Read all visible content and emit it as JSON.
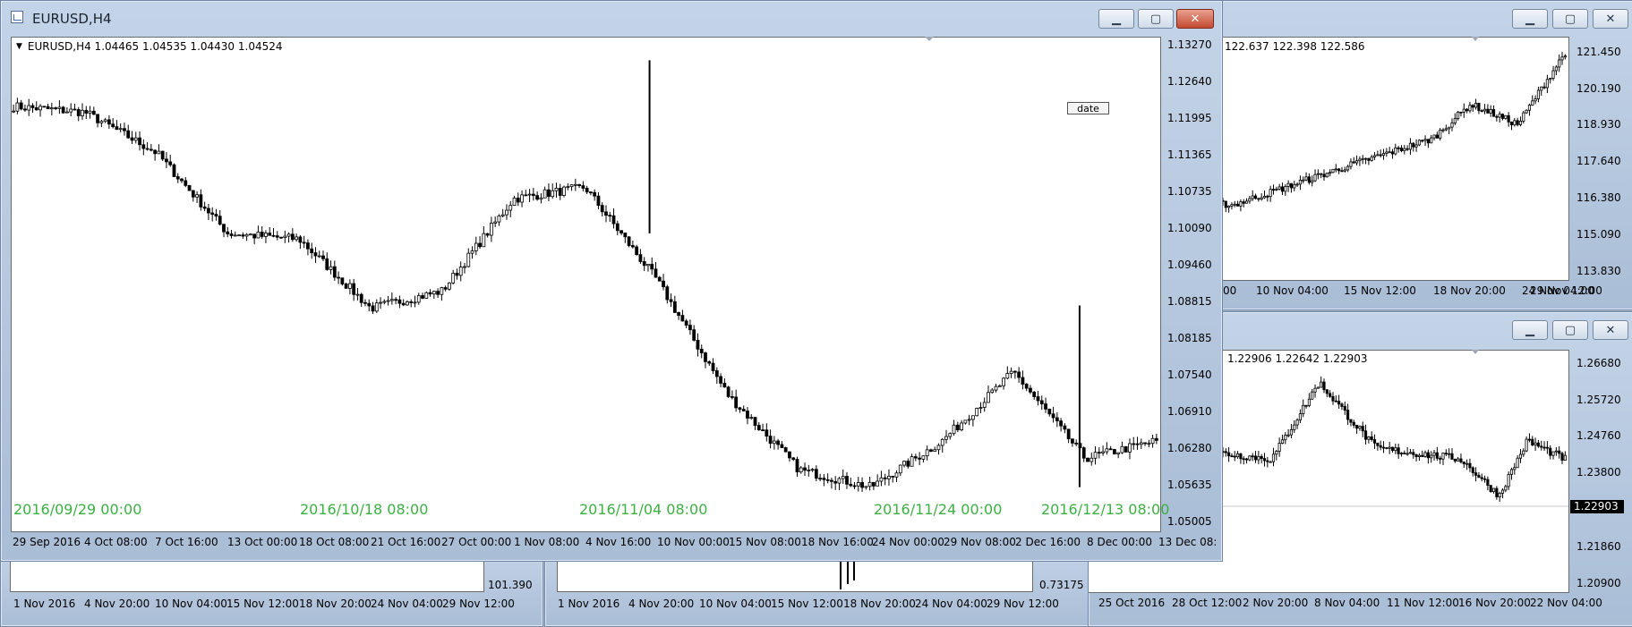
{
  "main_window": {
    "title": "EURUSD,H4",
    "ohlc_label": "EURUSD,H4  1.04465 1.04535 1.04430 1.04524",
    "date_button": "date",
    "y_ticks": [
      "1.13270",
      "1.12640",
      "1.11995",
      "1.11365",
      "1.10735",
      "1.10090",
      "1.09460",
      "1.08815",
      "1.08185",
      "1.07540",
      "1.06910",
      "1.06280",
      "1.05635",
      "1.05005"
    ],
    "x_ticks": [
      "29 Sep 2016",
      "4 Oct 08:00",
      "7 Oct 16:00",
      "13 Oct 00:00",
      "18 Oct 08:00",
      "21 Oct 16:00",
      "27 Oct 00:00",
      "1 Nov 08:00",
      "4 Nov 16:00",
      "10 Nov 00:00",
      "15 Nov 08:00",
      "18 Nov 16:00",
      "24 Nov 00:00",
      "29 Nov 08:00",
      "2 Dec 16:00",
      "8 Dec 00:00",
      "13 Dec 08:"
    ],
    "date_markers": [
      "2016/09/29 00:00",
      "2016/10/18 08:00",
      "2016/11/04 08:00",
      "2016/11/24 00:00",
      "2016/12/13 08:00"
    ],
    "colors": {
      "marker": "#3cb043",
      "candle": "#000000"
    }
  },
  "top_right_window": {
    "ohlc_label": "122.637 122.398 122.586",
    "y_ticks": [
      "121.450",
      "120.190",
      "118.930",
      "117.640",
      "116.380",
      "115.090",
      "113.830"
    ],
    "x_ticks": [
      "00",
      "10 Nov 04:00",
      "15 Nov 12:00",
      "18 Nov 20:00",
      "24 Nov 04:00",
      "29 Nov 12:00"
    ]
  },
  "bottom_right_window": {
    "ohlc_label": "1.22906 1.22642 1.22903",
    "price_tag": "1.22903",
    "y_ticks": [
      "1.26680",
      "1.25720",
      "1.24760",
      "1.23800",
      "1.21860",
      "1.20900"
    ],
    "x_ticks": [
      "25 Oct 2016",
      "28 Oct 12:00",
      "2 Nov 20:00",
      "8 Nov 04:00",
      "11 Nov 12:00",
      "16 Nov 20:00",
      "22 Nov 04:00"
    ]
  },
  "bottom_left_window": {
    "y_tick": "101.390",
    "x_ticks": [
      "1 Nov 2016",
      "4 Nov 20:00",
      "10 Nov 04:00",
      "15 Nov 12:00",
      "18 Nov 20:00",
      "24 Nov 04:00",
      "29 Nov 12:00"
    ]
  },
  "bottom_middle_window": {
    "y_tick": "0.73175",
    "x_ticks": [
      "1 Nov 2016",
      "4 Nov 20:00",
      "10 Nov 04:00",
      "15 Nov 12:00",
      "18 Nov 20:00",
      "24 Nov 04:00",
      "29 Nov 12:00"
    ]
  },
  "chart_data": {
    "type": "candlestick",
    "symbol": "EURUSD",
    "timeframe": "H4",
    "ylim": [
      1.05005,
      1.1327
    ],
    "last": {
      "open": 1.04465,
      "high": 1.04535,
      "low": 1.0443,
      "close": 1.04524
    },
    "close_path": [
      {
        "x": "29 Sep 2016",
        "y": 1.122
      },
      {
        "x": "4 Oct 08:00",
        "y": 1.121
      },
      {
        "x": "7 Oct 16:00",
        "y": 1.114
      },
      {
        "x": "13 Oct 00:00",
        "y": 1.1
      },
      {
        "x": "18 Oct 08:00",
        "y": 1.099
      },
      {
        "x": "21 Oct 16:00",
        "y": 1.087
      },
      {
        "x": "27 Oct 00:00",
        "y": 1.09
      },
      {
        "x": "1 Nov 08:00",
        "y": 1.106
      },
      {
        "x": "4 Nov 16:00",
        "y": 1.108
      },
      {
        "x": "10 Nov 00:00",
        "y": 1.092
      },
      {
        "x": "15 Nov 08:00",
        "y": 1.072
      },
      {
        "x": "18 Nov 16:00",
        "y": 1.059
      },
      {
        "x": "24 Nov 00:00",
        "y": 1.056
      },
      {
        "x": "29 Nov 08:00",
        "y": 1.064
      },
      {
        "x": "2 Dec 16:00",
        "y": 1.076
      },
      {
        "x": "8 Dec 00:00",
        "y": 1.061
      },
      {
        "x": "13 Dec 08:",
        "y": 1.064
      }
    ],
    "spikes": [
      {
        "x": "10 Nov 00:00",
        "high": 1.13,
        "low": 1.1
      },
      {
        "x": "8 Dec 00:00",
        "high": 1.0875,
        "low": 1.056
      }
    ]
  }
}
